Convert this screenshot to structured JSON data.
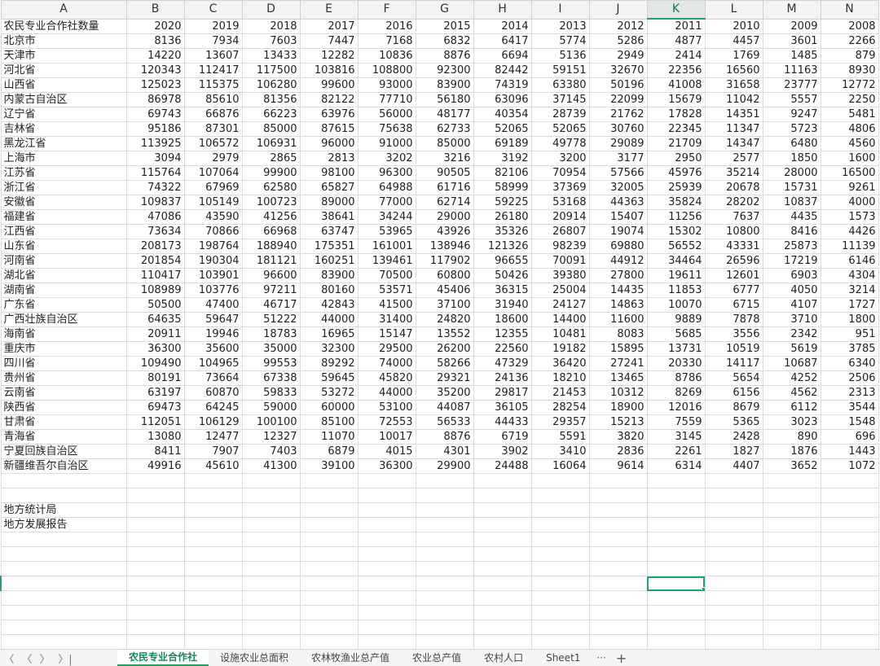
{
  "columns": [
    {
      "letter": "A",
      "width": 154
    },
    {
      "letter": "B",
      "width": 71
    },
    {
      "letter": "C",
      "width": 71
    },
    {
      "letter": "D",
      "width": 71
    },
    {
      "letter": "E",
      "width": 71
    },
    {
      "letter": "F",
      "width": 71
    },
    {
      "letter": "G",
      "width": 71
    },
    {
      "letter": "H",
      "width": 71
    },
    {
      "letter": "I",
      "width": 71
    },
    {
      "letter": "J",
      "width": 71
    },
    {
      "letter": "K",
      "width": 71
    },
    {
      "letter": "L",
      "width": 71
    },
    {
      "letter": "M",
      "width": 71
    },
    {
      "letter": "N",
      "width": 71
    }
  ],
  "active_column": "K",
  "header_row": [
    "农民专业合作社数量",
    "2020",
    "2019",
    "2018",
    "2017",
    "2016",
    "2015",
    "2014",
    "2013",
    "2012",
    "2011",
    "2010",
    "2009",
    "2008"
  ],
  "rows": [
    [
      "北京市",
      "8136",
      "7934",
      "7603",
      "7447",
      "7168",
      "6832",
      "6417",
      "5774",
      "5286",
      "4877",
      "4457",
      "3601",
      "2266"
    ],
    [
      "天津市",
      "14220",
      "13607",
      "13433",
      "12282",
      "10836",
      "8876",
      "6694",
      "5136",
      "2949",
      "2414",
      "1769",
      "1485",
      "879"
    ],
    [
      "河北省",
      "120343",
      "112417",
      "117500",
      "103816",
      "108800",
      "92300",
      "82442",
      "59151",
      "32670",
      "22356",
      "16560",
      "11163",
      "8930"
    ],
    [
      "山西省",
      "125023",
      "115375",
      "106280",
      "99600",
      "93000",
      "83900",
      "74319",
      "63380",
      "50196",
      "41008",
      "31658",
      "23777",
      "12772"
    ],
    [
      "内蒙古自治区",
      "86978",
      "85610",
      "81356",
      "82122",
      "77710",
      "56180",
      "63096",
      "37145",
      "22099",
      "15679",
      "11042",
      "5557",
      "2250"
    ],
    [
      "辽宁省",
      "69743",
      "66876",
      "66223",
      "63976",
      "56000",
      "48177",
      "40354",
      "28739",
      "21762",
      "17828",
      "14351",
      "9247",
      "5481"
    ],
    [
      "吉林省",
      "95186",
      "87301",
      "85000",
      "87615",
      "75638",
      "62733",
      "52065",
      "52065",
      "30760",
      "22345",
      "11347",
      "5723",
      "4806"
    ],
    [
      "黑龙江省",
      "113925",
      "106572",
      "106931",
      "96000",
      "91000",
      "85000",
      "69189",
      "49778",
      "29089",
      "21709",
      "14347",
      "6480",
      "4560"
    ],
    [
      "上海市",
      "3094",
      "2979",
      "2865",
      "2813",
      "3202",
      "3216",
      "3192",
      "3200",
      "3177",
      "2950",
      "2577",
      "1850",
      "1600"
    ],
    [
      "江苏省",
      "115764",
      "107064",
      "99900",
      "98100",
      "96300",
      "90505",
      "82106",
      "70954",
      "57566",
      "45976",
      "35214",
      "28000",
      "16500"
    ],
    [
      "浙江省",
      "74322",
      "67969",
      "62580",
      "65827",
      "64988",
      "61716",
      "58999",
      "37369",
      "32005",
      "25939",
      "20678",
      "15731",
      "9261"
    ],
    [
      "安徽省",
      "109837",
      "105149",
      "100723",
      "89000",
      "77000",
      "62714",
      "59225",
      "53168",
      "44363",
      "35824",
      "28202",
      "10837",
      "4000"
    ],
    [
      "福建省",
      "47086",
      "43590",
      "41256",
      "38641",
      "34244",
      "29000",
      "26180",
      "20914",
      "15407",
      "11256",
      "7637",
      "4435",
      "1573"
    ],
    [
      "江西省",
      "73634",
      "70866",
      "66968",
      "63747",
      "53965",
      "43926",
      "35326",
      "26807",
      "19074",
      "15302",
      "10800",
      "8416",
      "4426"
    ],
    [
      "山东省",
      "208173",
      "198764",
      "188940",
      "175351",
      "161001",
      "138946",
      "121326",
      "98239",
      "69880",
      "56552",
      "43331",
      "25873",
      "11139"
    ],
    [
      "河南省",
      "201854",
      "190304",
      "181121",
      "160251",
      "139461",
      "117902",
      "96655",
      "70091",
      "44912",
      "34464",
      "26596",
      "17219",
      "6146"
    ],
    [
      "湖北省",
      "110417",
      "103901",
      "96600",
      "83900",
      "70500",
      "60800",
      "50426",
      "39380",
      "27800",
      "19611",
      "12601",
      "6903",
      "4304"
    ],
    [
      "湖南省",
      "108989",
      "103776",
      "97211",
      "80160",
      "53571",
      "45406",
      "36315",
      "25004",
      "14435",
      "11853",
      "6777",
      "4050",
      "3214"
    ],
    [
      "广东省",
      "50500",
      "47400",
      "46717",
      "42843",
      "41500",
      "37100",
      "31940",
      "24127",
      "14863",
      "10070",
      "6715",
      "4107",
      "1727"
    ],
    [
      "广西壮族自治区",
      "64635",
      "59647",
      "51222",
      "44000",
      "31400",
      "24820",
      "18600",
      "14400",
      "11600",
      "9889",
      "7878",
      "3710",
      "1800"
    ],
    [
      "海南省",
      "20911",
      "19946",
      "18783",
      "16965",
      "15147",
      "13552",
      "12355",
      "10481",
      "8083",
      "5685",
      "3556",
      "2342",
      "951"
    ],
    [
      "重庆市",
      "36300",
      "35600",
      "35000",
      "32300",
      "29500",
      "26200",
      "22560",
      "19182",
      "15895",
      "13731",
      "10519",
      "5619",
      "3785"
    ],
    [
      "四川省",
      "109490",
      "104965",
      "99553",
      "89292",
      "74000",
      "58266",
      "47329",
      "36420",
      "27241",
      "20330",
      "14117",
      "10687",
      "6340"
    ],
    [
      "贵州省",
      "80191",
      "73664",
      "67338",
      "59645",
      "45820",
      "29321",
      "24136",
      "18210",
      "13465",
      "8786",
      "5654",
      "4252",
      "2506"
    ],
    [
      "云南省",
      "63197",
      "60870",
      "59833",
      "53272",
      "44000",
      "35200",
      "29817",
      "21453",
      "10312",
      "8269",
      "6156",
      "4562",
      "2313"
    ],
    [
      "陕西省",
      "69473",
      "64245",
      "59000",
      "60000",
      "53100",
      "44087",
      "36105",
      "28254",
      "18900",
      "12016",
      "8679",
      "6112",
      "3544"
    ],
    [
      "甘肃省",
      "112051",
      "106129",
      "100100",
      "85100",
      "72553",
      "56533",
      "44433",
      "29357",
      "15213",
      "7559",
      "5365",
      "3023",
      "1548"
    ],
    [
      "青海省",
      "13080",
      "12477",
      "12327",
      "11070",
      "10017",
      "8876",
      "6719",
      "5591",
      "3820",
      "3145",
      "2428",
      "890",
      "696"
    ],
    [
      "宁夏回族自治区",
      "8411",
      "7907",
      "7403",
      "6879",
      "4015",
      "4301",
      "3902",
      "3410",
      "2836",
      "2261",
      "1827",
      "1876",
      "1443"
    ],
    [
      "新疆维吾尔自治区",
      "49916",
      "45610",
      "41300",
      "39100",
      "36300",
      "29900",
      "24488",
      "16064",
      "9614",
      "6314",
      "4407",
      "3652",
      "1072"
    ]
  ],
  "notes": [
    "地方统计局",
    "地方发展报告"
  ],
  "empty_rows_before_notes": 2,
  "empty_rows_after_notes": 9,
  "selected_cell": {
    "row_index_after_notes": 3,
    "column": "K"
  },
  "sheet_tabs": [
    {
      "label": "农民专业合作社",
      "active": true
    },
    {
      "label": "设施农业总面积",
      "active": false
    },
    {
      "label": "农林牧渔业总产值",
      "active": false
    },
    {
      "label": "农业总产值",
      "active": false
    },
    {
      "label": "农村人口",
      "active": false
    },
    {
      "label": "Sheet1",
      "active": false
    }
  ],
  "tab_nav": {
    "first": "〈",
    "prev": "〈",
    "next": "〉",
    "last": "〉|",
    "more": "···",
    "add": "+"
  },
  "colors": {
    "accent": "#21a366",
    "header_bg": "#f3f3f3",
    "grid": "#dcdcdc"
  }
}
